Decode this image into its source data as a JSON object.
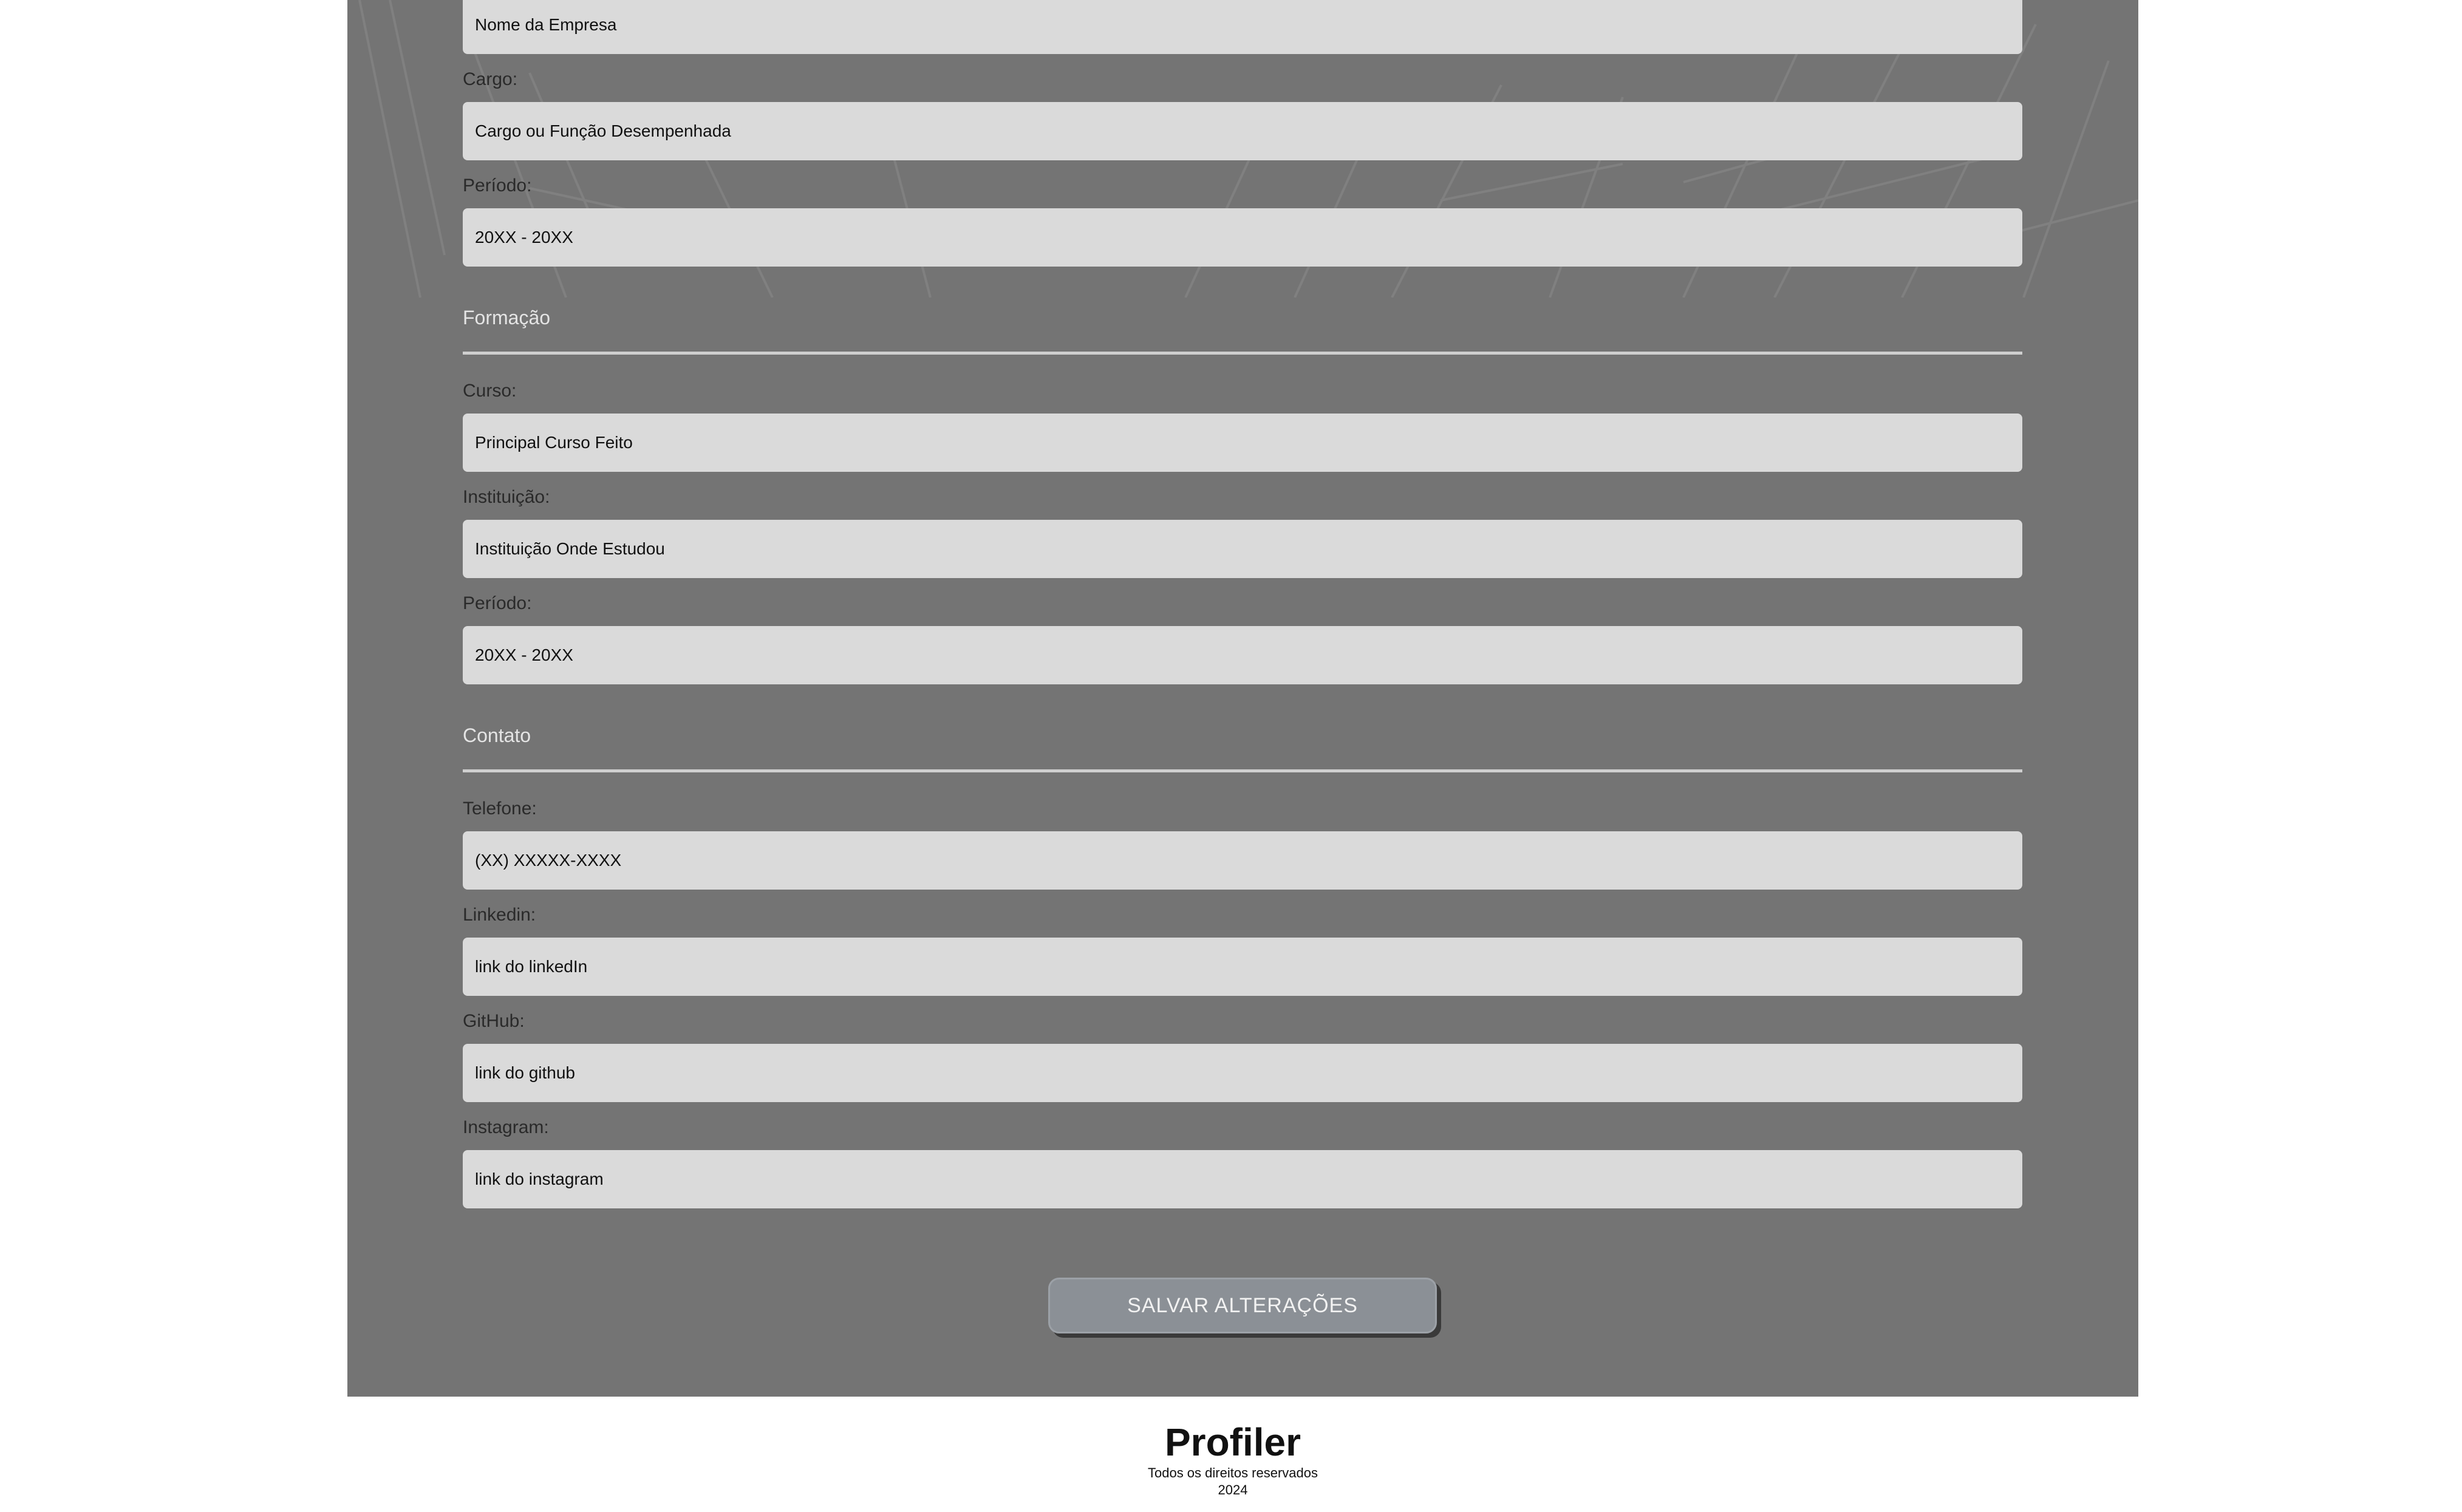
{
  "experience": {
    "company_value": "Nome da Empresa",
    "role_label": "Cargo:",
    "role_value": "Cargo ou Função Desempenhada",
    "period_label": "Período:",
    "period_value": "20XX - 20XX"
  },
  "education": {
    "section_title": "Formação",
    "course_label": "Curso:",
    "course_value": "Principal Curso Feito",
    "institution_label": "Instituição:",
    "institution_value": "Instituição Onde Estudou",
    "period_label": "Período:",
    "period_value": "20XX - 20XX"
  },
  "contact": {
    "section_title": "Contato",
    "phone_label": "Telefone:",
    "phone_value": "(XX) XXXXX-XXXX",
    "linkedin_label": "Linkedin:",
    "linkedin_value": "link do linkedIn",
    "github_label": "GitHub:",
    "github_value": "link do github",
    "instagram_label": "Instagram:",
    "instagram_value": "link do instagram"
  },
  "actions": {
    "save_label": "SALVAR ALTERAÇÕES"
  },
  "footer": {
    "brand": "Profiler",
    "rights": "Todos os direitos reservados",
    "year": "2024"
  },
  "colors": {
    "panel_background": "#747474",
    "input_background": "#dadada",
    "button_background": "#8b9096",
    "page_background": "#ffffff"
  }
}
